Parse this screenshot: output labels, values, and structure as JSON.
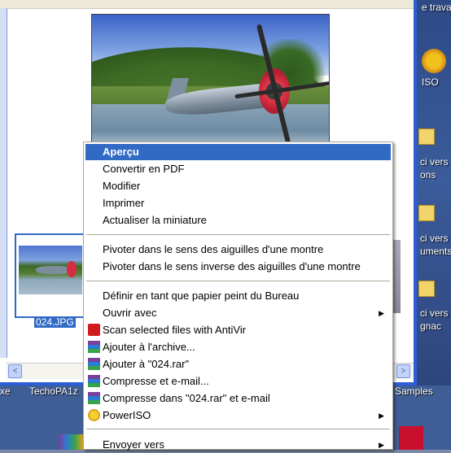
{
  "desktop": {
    "labels": [
      "e travail",
      "ISO",
      "ci vers",
      "ons",
      "ci vers",
      "uments",
      "ci vers",
      "gnac",
      "Samples"
    ]
  },
  "thumbnail": {
    "label": "024.JPG"
  },
  "taskbar": {
    "left_text": "xe",
    "item_text": "TechoPA1z"
  },
  "context_menu": {
    "items": [
      {
        "label": "Aperçu",
        "highlighted": true
      },
      {
        "label": "Convertir en PDF"
      },
      {
        "label": "Modifier"
      },
      {
        "label": "Imprimer"
      },
      {
        "label": "Actualiser la miniature"
      },
      {
        "label": "Pivoter dans le sens des aiguilles d'une montre"
      },
      {
        "label": "Pivoter dans le sens inverse des aiguilles d'une montre"
      },
      {
        "label": "Définir en tant que papier peint du Bureau"
      },
      {
        "label": "Ouvrir avec",
        "submenu": true
      },
      {
        "label": "Scan selected files with AntiVir",
        "icon": "antivir-icon"
      },
      {
        "label": "Ajouter à l'archive...",
        "icon": "winrar-icon"
      },
      {
        "label": "Ajouter à \"024.rar\"",
        "icon": "winrar-icon"
      },
      {
        "label": "Compresse et e-mail...",
        "icon": "winrar-icon"
      },
      {
        "label": "Compresse dans \"024.rar\" et e-mail",
        "icon": "winrar-icon"
      },
      {
        "label": "PowerISO",
        "icon": "poweriso-icon",
        "submenu": true
      },
      {
        "label": "Envoyer vers",
        "submenu": true
      }
    ],
    "highlight_color": "#316ac5"
  },
  "scrollbar": {
    "left_arrow": "<",
    "right_arrow": ">"
  }
}
